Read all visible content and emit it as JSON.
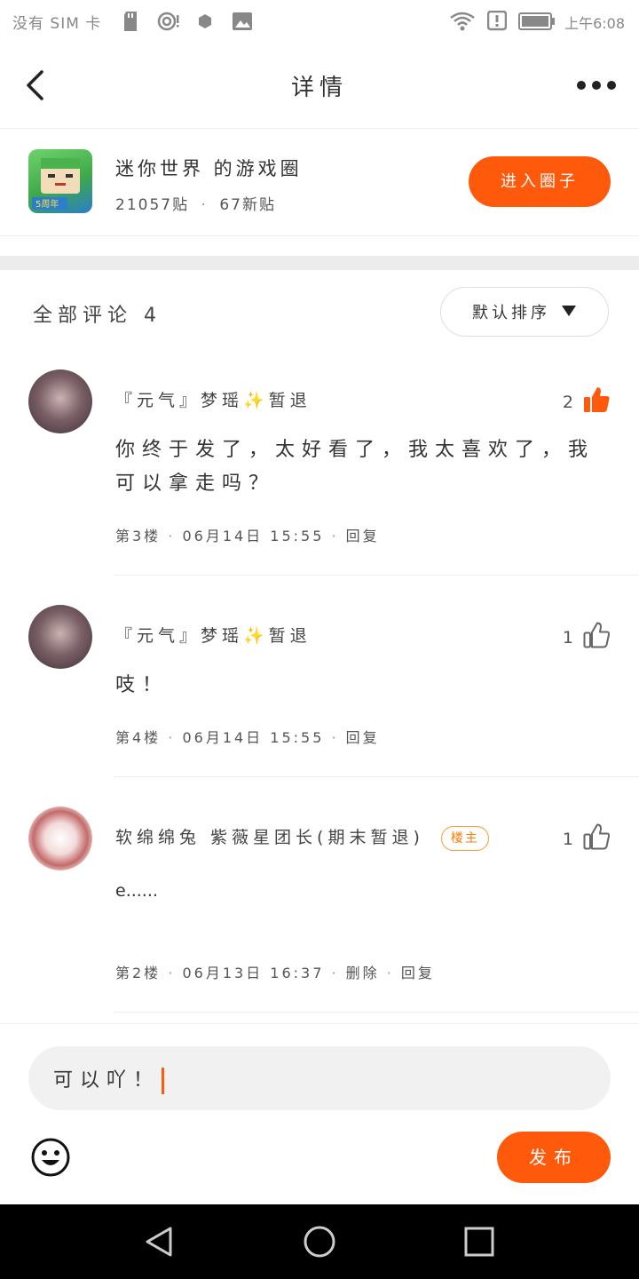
{
  "status_bar": {
    "carrier": "没有 SIM 卡",
    "time": "上午6:08",
    "icons": [
      "sd-card-icon",
      "hotspot-icon",
      "dot-icon",
      "image-icon",
      "wifi-icon",
      "alert-icon",
      "battery-icon"
    ]
  },
  "header": {
    "title": "详情",
    "back_icon": "back-chevron-icon",
    "more_icon": "more-dots-icon"
  },
  "circle": {
    "name": "迷你世界 的游戏圈",
    "posts": "21057贴",
    "separator": "·",
    "new_posts": "67新贴",
    "join_label": "进入圈子"
  },
  "comments_section": {
    "title": "全部评论 4",
    "sort_label": "默认排序"
  },
  "comments": [
    {
      "user": "『元气』梦瑶✨暂退",
      "likes": "2",
      "liked": true,
      "body": "你终于发了，太好看了，我太喜欢了，我可以拿走吗？",
      "meta_floor": "第3楼",
      "meta_date": "06月14日 15:55",
      "meta_reply": "回复"
    },
    {
      "user": "『元气』梦瑶✨暂退",
      "likes": "1",
      "liked": false,
      "body": "吱！",
      "meta_floor": "第4楼",
      "meta_date": "06月14日 15:55",
      "meta_reply": "回复"
    },
    {
      "user": "软绵绵兔 紫薇星团长(期末暂退)",
      "badge": "楼主",
      "likes": "1",
      "liked": false,
      "body": "e......",
      "meta_floor": "第2楼",
      "meta_date": "06月13日 16:37",
      "meta_delete": "删除",
      "meta_reply": "回复"
    }
  ],
  "composer": {
    "value": "可以吖！",
    "publish_label": "发布",
    "emoji_icon": "emoji-icon"
  },
  "colors": {
    "accent": "#ff5a0c",
    "badge": "#ff9a2e"
  }
}
